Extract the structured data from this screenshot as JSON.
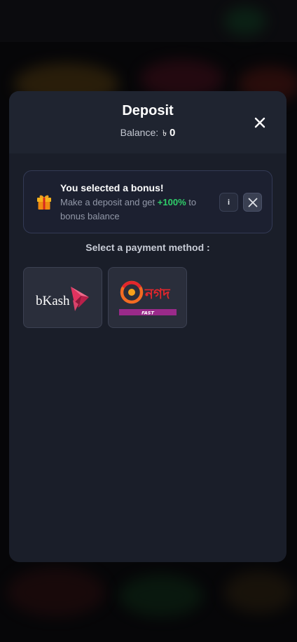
{
  "modal": {
    "title": "Deposit",
    "balance_label": "Balance:",
    "balance_currency": "৳",
    "balance_amount": "0"
  },
  "bonus": {
    "title": "You selected a bonus!",
    "desc_before": "Make a deposit and get",
    "desc_highlight": "+100%",
    "desc_after": "to bonus balance",
    "info_label": "i"
  },
  "payment": {
    "section_label": "Select a payment method :",
    "methods": [
      {
        "name": "bKash",
        "logo_text": "bKash"
      },
      {
        "name": "Nagad",
        "logo_text": "নগদ",
        "badge": "FAST"
      }
    ]
  },
  "colors": {
    "modal_bg": "#1a1e29",
    "header_bg": "#1f2430",
    "bonus_highlight": "#2fcf6a",
    "nagad_red": "#e2262c",
    "nagad_badge": "#9a2a8a",
    "bkash_pink": "#d9436b"
  }
}
